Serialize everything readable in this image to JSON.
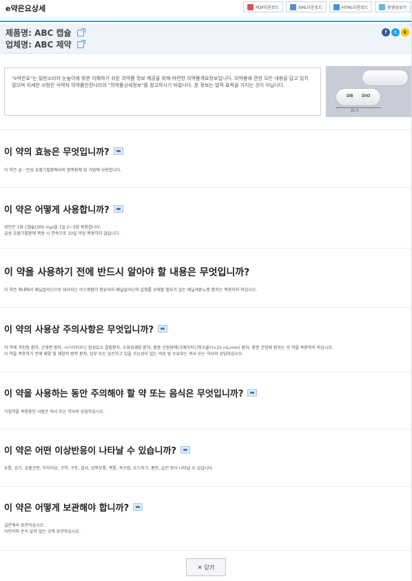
{
  "app": {
    "title": "e약은요상세"
  },
  "toolbar": {
    "buttons": [
      {
        "label": "PDF다운로드",
        "icon": "pdf-icon"
      },
      {
        "label": "XML다운로드",
        "icon": "xml-icon"
      },
      {
        "label": "HTML다운로드",
        "icon": "html-icon"
      },
      {
        "label": "동영상보기",
        "icon": "video-icon"
      }
    ]
  },
  "product": {
    "name_line": "제품명: ABC 캡슐",
    "company_line": "업체명: ABC 제약",
    "social": {
      "facebook": "f",
      "twitter": "t",
      "kakaostory": "k"
    }
  },
  "notice": {
    "text": "\"e약은요\"는 일반소비자 눈높이에 맞춘 이해하기 쉬운 의약품 정보 제공을 위해 마련한 의약품개요정보입니다. 의약품에 관한 모든 내용을 담고 있지 않으며 자세한 사항은 식약처 의약품안전나라의 \"의약품상세정보\"를 참고하시기 바랍니다. 본 정보는 법적 효력을 가지는 것이 아닙니다."
  },
  "pill_image": {
    "mark_left": "DB",
    "mark_right": "DIO",
    "dimension": "21.3"
  },
  "sections": [
    {
      "title": "이 약의 효능은 무엇입니까?",
      "body": [
        "이 약은 급・만성 호흡기질환에서의 점액용해 및 거담에 사용합니다."
      ]
    },
    {
      "title": "이 약은 어떻게 사용합니까?",
      "body": [
        "성인은 1회 1캡슐(300 mg)을 1일 2~3회 복용합니다.",
        "급성 호흡기질환에 복용    시 연속으로 10일 이상 복용하지 않습니다."
      ]
    },
    {
      "title": "이 약을 사용하기 전에 반드시 알아야 할 내용은 무엇입니까?",
      "body": [
        "이 약은 체내에서 페닐알라닌으로 대사되는 아스파탐이 함유되어 페닐알라닌의 섭취를 규제할 필요가 있는 페닐케톤뇨증 환자는 복용하지 마십시오."
      ]
    },
    {
      "title": "이 약의 사용상 주의사항은 무엇입니까?",
      "body": [
        "이 약에 과민증 환자, 간경변 환자,    시스타티오닌 합성효소 결핍환자,    소화성궤양 환자,    중증 신장장애(크레아티닌청소율이<25 mL/min) 환자,    중증 간장애 환자는 이 약을 복용하지 마십시오.",
        "이 약을 복용하기 전에 궤양 및 궤양의 병력 환자, 임부 또는 임신하고 있을 가능성이 있는 여성 및 수유부는 의사 또는 약사와 상담하십시오."
      ]
    },
    {
      "title": "이 약을 사용하는 동안 주의해야 할 약 또는 음식은 무엇입니까?",
      "body": [
        "기침약을 복용중인 사람은 의사 또는 약사와 상담하십시오."
      ]
    },
    {
      "title": "이 약은 어떤 이상반응이 나타날 수 있습니까?",
      "body": [
        "두통, 감기, 호흡곤란, 미각이상, 구역, 구토, 설사, 상복부통, 복통, 속쓰림, 두드러기, 홍반, 습진 등이 나타날 수 있습니다."
      ]
    },
    {
      "title": "이 약은 어떻게 보관해야 합니까?",
      "body": [
        "실온에서 보관하십시오.",
        "어린이의 손이 닿지 않는 곳에 보관하십시오."
      ]
    }
  ],
  "footer": {
    "close_label": "닫기",
    "close_glyph": "✕"
  }
}
